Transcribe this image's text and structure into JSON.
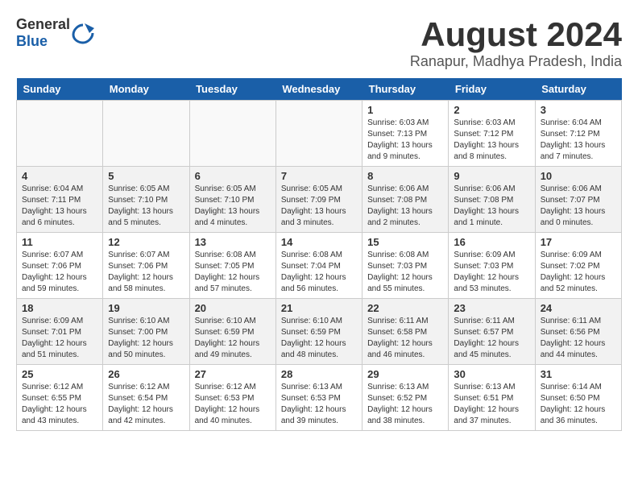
{
  "logo": {
    "text_general": "General",
    "text_blue": "Blue"
  },
  "title": {
    "month_year": "August 2024",
    "location": "Ranapur, Madhya Pradesh, India"
  },
  "days_of_week": [
    "Sunday",
    "Monday",
    "Tuesday",
    "Wednesday",
    "Thursday",
    "Friday",
    "Saturday"
  ],
  "weeks": [
    [
      {
        "day": "",
        "info": ""
      },
      {
        "day": "",
        "info": ""
      },
      {
        "day": "",
        "info": ""
      },
      {
        "day": "",
        "info": ""
      },
      {
        "day": "1",
        "info": "Sunrise: 6:03 AM\nSunset: 7:13 PM\nDaylight: 13 hours\nand 9 minutes."
      },
      {
        "day": "2",
        "info": "Sunrise: 6:03 AM\nSunset: 7:12 PM\nDaylight: 13 hours\nand 8 minutes."
      },
      {
        "day": "3",
        "info": "Sunrise: 6:04 AM\nSunset: 7:12 PM\nDaylight: 13 hours\nand 7 minutes."
      }
    ],
    [
      {
        "day": "4",
        "info": "Sunrise: 6:04 AM\nSunset: 7:11 PM\nDaylight: 13 hours\nand 6 minutes."
      },
      {
        "day": "5",
        "info": "Sunrise: 6:05 AM\nSunset: 7:10 PM\nDaylight: 13 hours\nand 5 minutes."
      },
      {
        "day": "6",
        "info": "Sunrise: 6:05 AM\nSunset: 7:10 PM\nDaylight: 13 hours\nand 4 minutes."
      },
      {
        "day": "7",
        "info": "Sunrise: 6:05 AM\nSunset: 7:09 PM\nDaylight: 13 hours\nand 3 minutes."
      },
      {
        "day": "8",
        "info": "Sunrise: 6:06 AM\nSunset: 7:08 PM\nDaylight: 13 hours\nand 2 minutes."
      },
      {
        "day": "9",
        "info": "Sunrise: 6:06 AM\nSunset: 7:08 PM\nDaylight: 13 hours\nand 1 minute."
      },
      {
        "day": "10",
        "info": "Sunrise: 6:06 AM\nSunset: 7:07 PM\nDaylight: 13 hours\nand 0 minutes."
      }
    ],
    [
      {
        "day": "11",
        "info": "Sunrise: 6:07 AM\nSunset: 7:06 PM\nDaylight: 12 hours\nand 59 minutes."
      },
      {
        "day": "12",
        "info": "Sunrise: 6:07 AM\nSunset: 7:06 PM\nDaylight: 12 hours\nand 58 minutes."
      },
      {
        "day": "13",
        "info": "Sunrise: 6:08 AM\nSunset: 7:05 PM\nDaylight: 12 hours\nand 57 minutes."
      },
      {
        "day": "14",
        "info": "Sunrise: 6:08 AM\nSunset: 7:04 PM\nDaylight: 12 hours\nand 56 minutes."
      },
      {
        "day": "15",
        "info": "Sunrise: 6:08 AM\nSunset: 7:03 PM\nDaylight: 12 hours\nand 55 minutes."
      },
      {
        "day": "16",
        "info": "Sunrise: 6:09 AM\nSunset: 7:03 PM\nDaylight: 12 hours\nand 53 minutes."
      },
      {
        "day": "17",
        "info": "Sunrise: 6:09 AM\nSunset: 7:02 PM\nDaylight: 12 hours\nand 52 minutes."
      }
    ],
    [
      {
        "day": "18",
        "info": "Sunrise: 6:09 AM\nSunset: 7:01 PM\nDaylight: 12 hours\nand 51 minutes."
      },
      {
        "day": "19",
        "info": "Sunrise: 6:10 AM\nSunset: 7:00 PM\nDaylight: 12 hours\nand 50 minutes."
      },
      {
        "day": "20",
        "info": "Sunrise: 6:10 AM\nSunset: 6:59 PM\nDaylight: 12 hours\nand 49 minutes."
      },
      {
        "day": "21",
        "info": "Sunrise: 6:10 AM\nSunset: 6:59 PM\nDaylight: 12 hours\nand 48 minutes."
      },
      {
        "day": "22",
        "info": "Sunrise: 6:11 AM\nSunset: 6:58 PM\nDaylight: 12 hours\nand 46 minutes."
      },
      {
        "day": "23",
        "info": "Sunrise: 6:11 AM\nSunset: 6:57 PM\nDaylight: 12 hours\nand 45 minutes."
      },
      {
        "day": "24",
        "info": "Sunrise: 6:11 AM\nSunset: 6:56 PM\nDaylight: 12 hours\nand 44 minutes."
      }
    ],
    [
      {
        "day": "25",
        "info": "Sunrise: 6:12 AM\nSunset: 6:55 PM\nDaylight: 12 hours\nand 43 minutes."
      },
      {
        "day": "26",
        "info": "Sunrise: 6:12 AM\nSunset: 6:54 PM\nDaylight: 12 hours\nand 42 minutes."
      },
      {
        "day": "27",
        "info": "Sunrise: 6:12 AM\nSunset: 6:53 PM\nDaylight: 12 hours\nand 40 minutes."
      },
      {
        "day": "28",
        "info": "Sunrise: 6:13 AM\nSunset: 6:53 PM\nDaylight: 12 hours\nand 39 minutes."
      },
      {
        "day": "29",
        "info": "Sunrise: 6:13 AM\nSunset: 6:52 PM\nDaylight: 12 hours\nand 38 minutes."
      },
      {
        "day": "30",
        "info": "Sunrise: 6:13 AM\nSunset: 6:51 PM\nDaylight: 12 hours\nand 37 minutes."
      },
      {
        "day": "31",
        "info": "Sunrise: 6:14 AM\nSunset: 6:50 PM\nDaylight: 12 hours\nand 36 minutes."
      }
    ]
  ]
}
